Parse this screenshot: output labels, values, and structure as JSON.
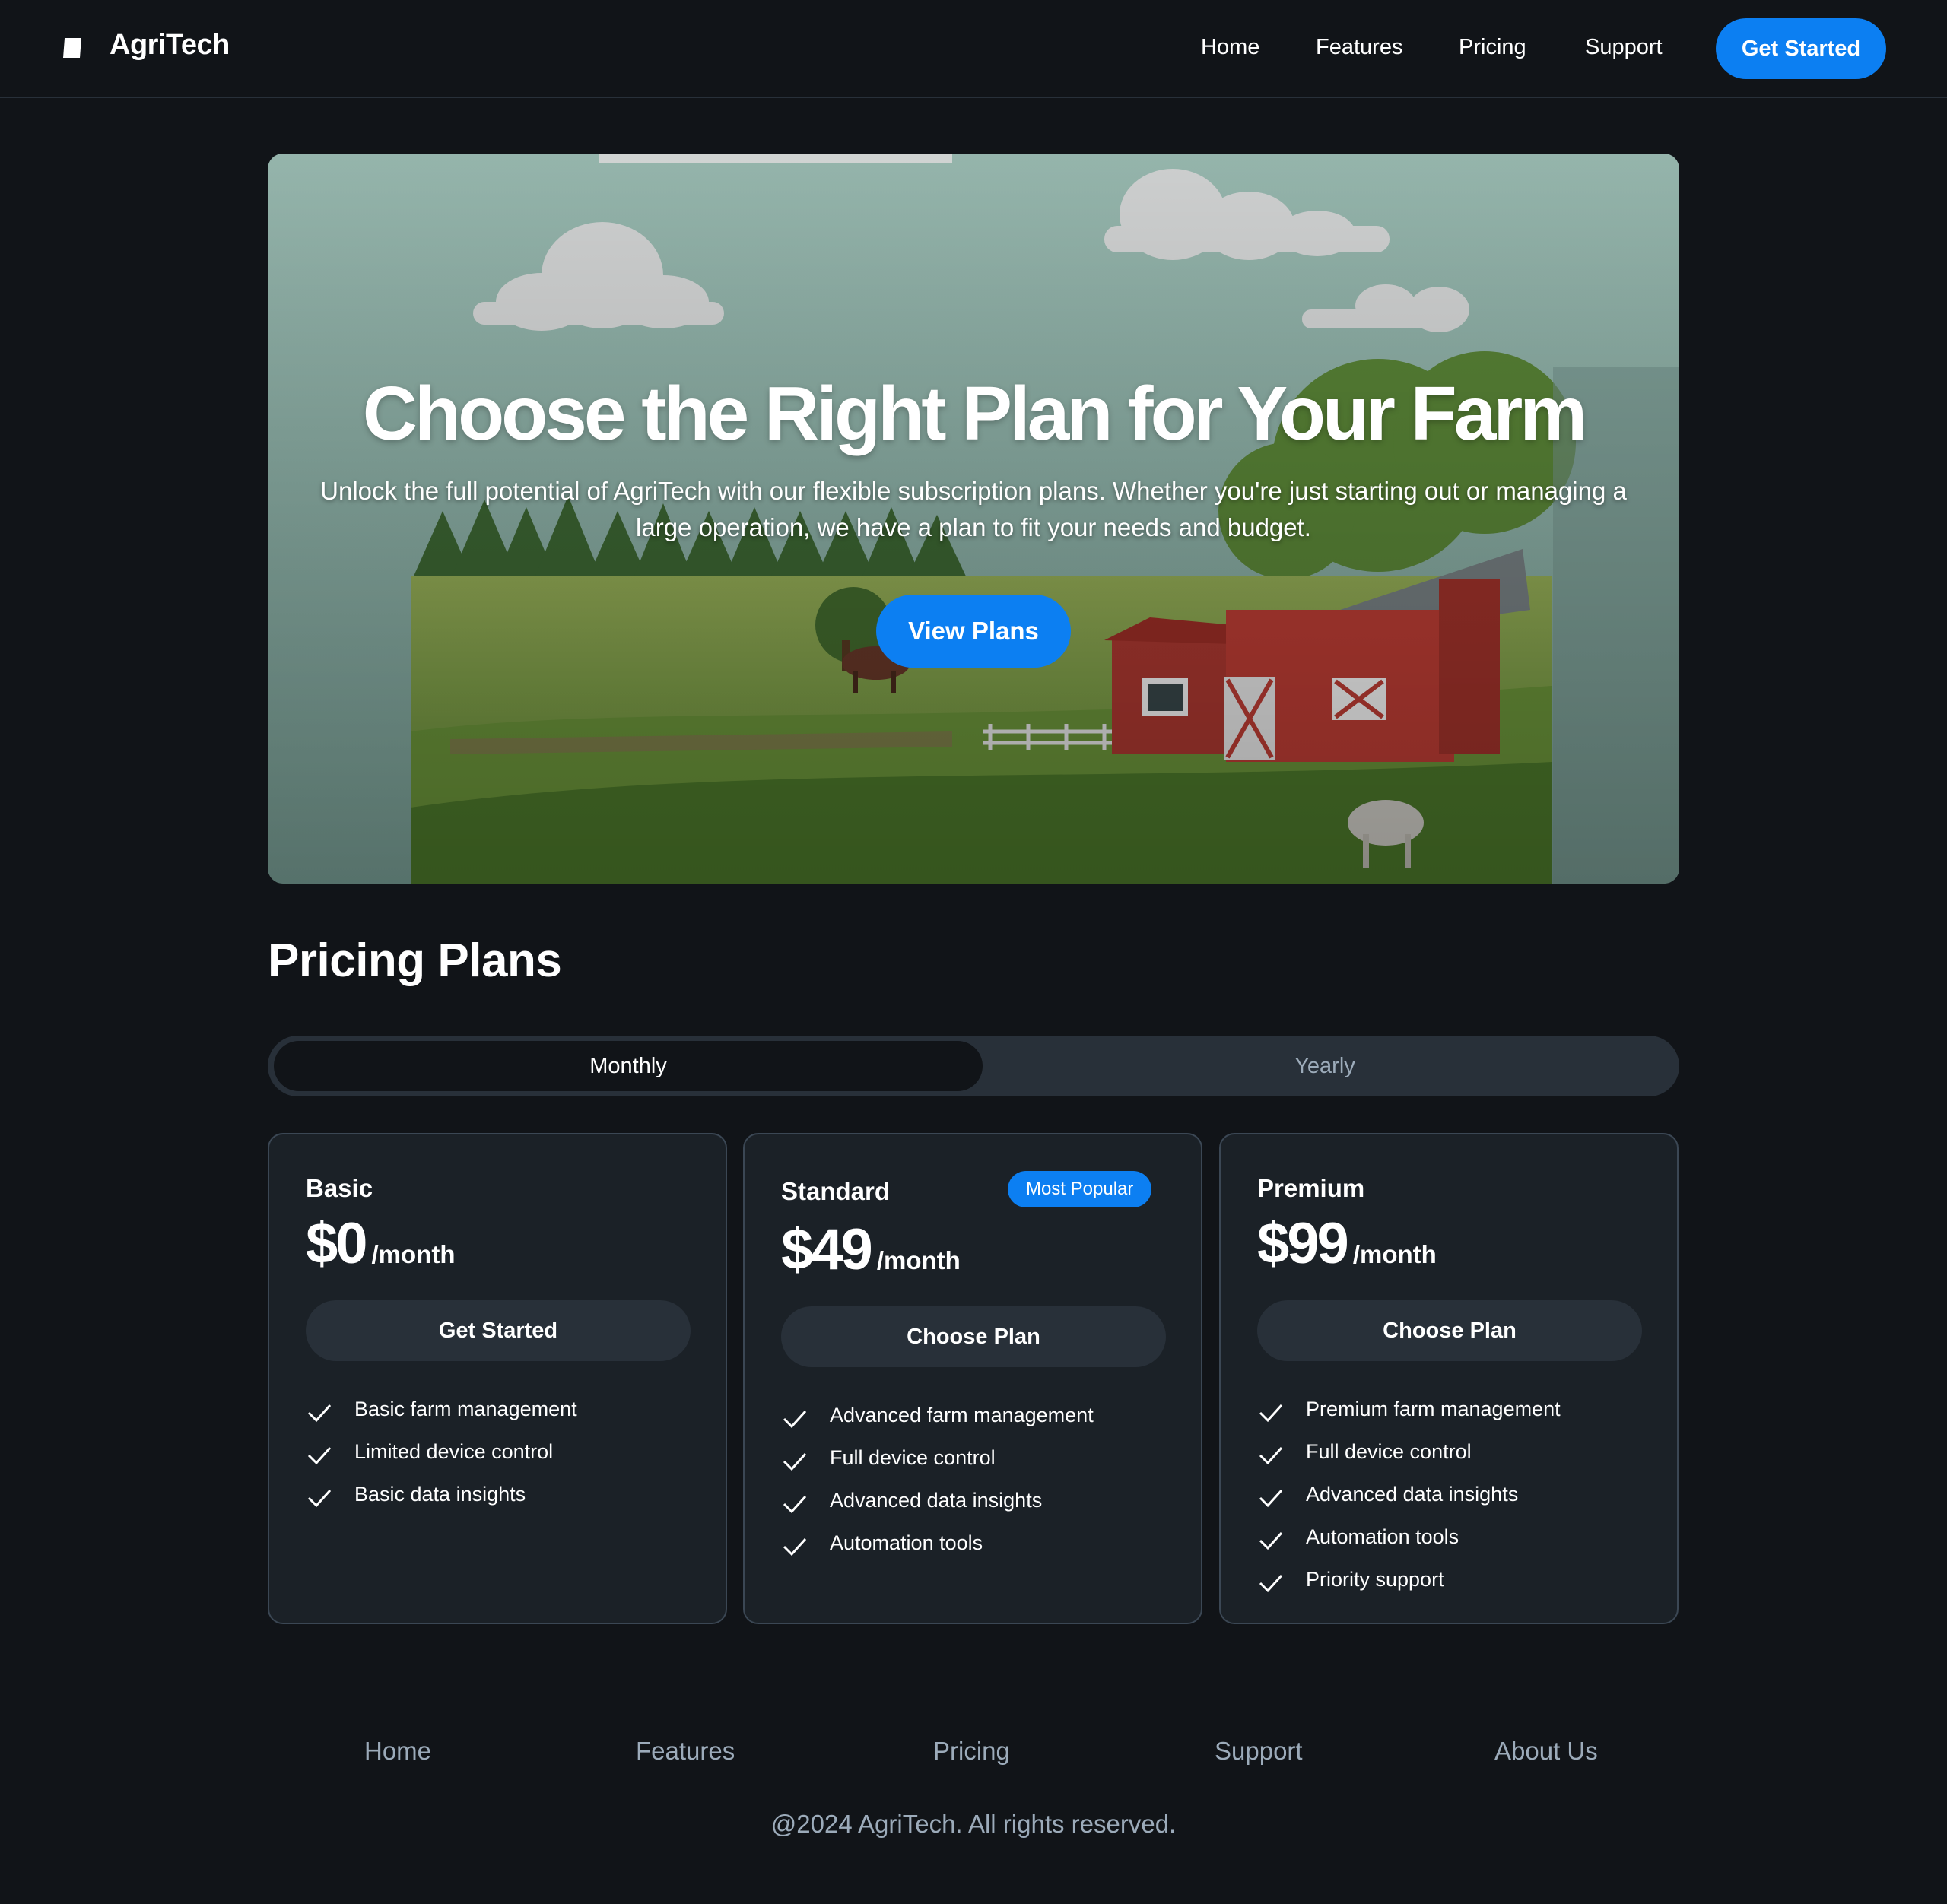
{
  "header": {
    "brand": "AgriTech",
    "nav": [
      "Home",
      "Features",
      "Pricing",
      "Support"
    ],
    "cta_label": "Get Started"
  },
  "hero": {
    "title": "Choose the Right Plan for Your Farm",
    "subtitle": "Unlock the full potential of AgriTech with our flexible subscription plans. Whether you're just starting out or managing a large operation, we have a plan to fit your needs and budget.",
    "cta_label": "View Plans"
  },
  "pricing": {
    "title": "Pricing Plans",
    "toggle": {
      "selected": "Monthly",
      "options": [
        "Monthly",
        "Yearly"
      ]
    },
    "plans": [
      {
        "name": "Basic",
        "price": "$0",
        "period": "/month",
        "button": "Get Started",
        "features": [
          "Basic farm management",
          "Limited device control",
          "Basic data insights"
        ]
      },
      {
        "name": "Standard",
        "badge": "Most Popular",
        "price": "$49",
        "period": "/month",
        "button": "Choose Plan",
        "features": [
          "Advanced farm management",
          "Full device control",
          "Advanced data insights",
          "Automation tools"
        ]
      },
      {
        "name": "Premium",
        "price": "$99",
        "period": "/month",
        "button": "Choose Plan",
        "features": [
          "Premium farm management",
          "Full device control",
          "Advanced data insights",
          "Automation tools",
          "Priority support"
        ]
      }
    ]
  },
  "footer": {
    "links": [
      "Home",
      "Features",
      "Pricing",
      "Support",
      "About Us"
    ],
    "copyright": "@2024 AgriTech. All rights reserved."
  },
  "colors": {
    "background": "#111418",
    "accent": "#0c7ff2",
    "card": "#1b2127",
    "card_border": "#3b4754",
    "muted_text": "#9cabba",
    "secondary_button": "#283039"
  },
  "icons": {
    "logo": "square-logo-icon",
    "check": "check-icon"
  }
}
